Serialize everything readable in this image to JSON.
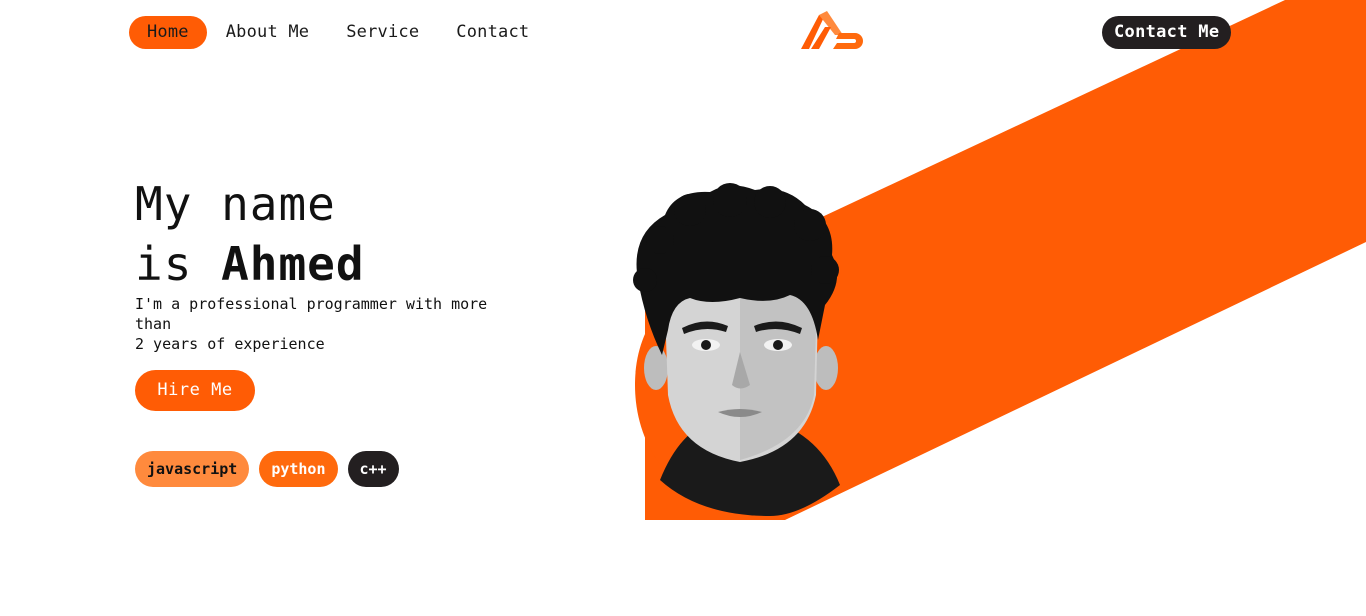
{
  "nav": {
    "items": [
      {
        "label": "Home",
        "active": true
      },
      {
        "label": "About Me",
        "active": false
      },
      {
        "label": "Service",
        "active": false
      },
      {
        "label": "Contact",
        "active": false
      }
    ]
  },
  "header": {
    "cta_label": "Contact Me"
  },
  "hero": {
    "title_line1": "My name",
    "title_prefix": "is ",
    "title_name": "Ahmed",
    "tagline_line1": "I'm a professional programmer with more than",
    "tagline_line2": "2 years of experience",
    "hire_label": "Hire Me"
  },
  "skills": [
    {
      "label": "javascript"
    },
    {
      "label": "python"
    },
    {
      "label": "c++"
    }
  ],
  "colors": {
    "accent": "#ff5c05",
    "accent_light": "#ff8a3d",
    "dark": "#231f20",
    "background": "#ffffff"
  }
}
